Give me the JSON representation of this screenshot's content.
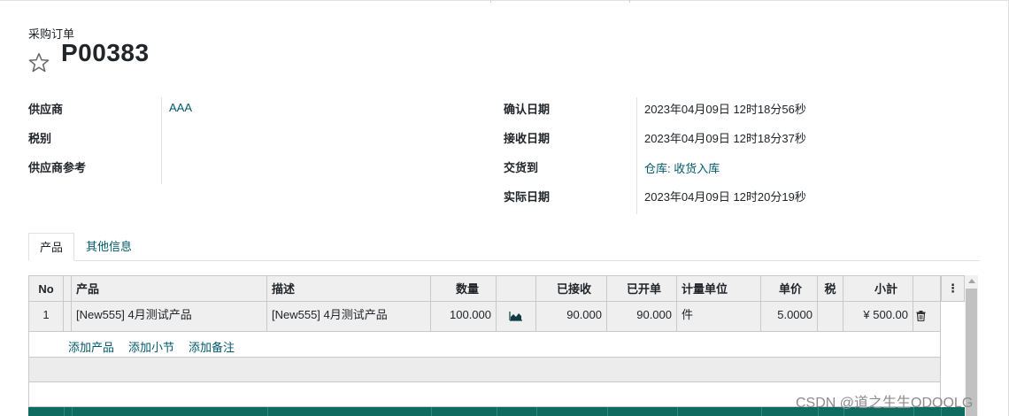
{
  "breadcrumb": "采购订单",
  "order_name": "P00383",
  "icons": {
    "favorite": "star-icon",
    "chart": "area-chart-icon",
    "delete": "trash-icon",
    "options": "kebab-icon"
  },
  "fields_left": [
    {
      "label": "供应商",
      "value": "AAA"
    },
    {
      "label": "税别",
      "value": ""
    },
    {
      "label": "供应商参考",
      "value": ""
    }
  ],
  "fields_right": [
    {
      "label": "确认日期",
      "value": "2023年04月09日 12时18分56秒"
    },
    {
      "label": "接收日期",
      "value": "2023年04月09日 12时18分37秒"
    },
    {
      "label": "交货到",
      "value": "仓库: 收货入库"
    },
    {
      "label": "实际日期",
      "value": "2023年04月09日 12时20分19秒"
    }
  ],
  "tabs": [
    {
      "label": "产品",
      "active": true
    },
    {
      "label": "其他信息",
      "active": false
    }
  ],
  "table": {
    "headers": {
      "no": "No",
      "product": "产品",
      "description": "描述",
      "quantity": "数量",
      "received": "已接收",
      "invoiced": "已开单",
      "uom": "计量单位",
      "price": "单价",
      "tax": "税",
      "subtotal": "小計"
    },
    "row": {
      "no": "1",
      "product": "[New555] 4月测试产品",
      "description": "[New555] 4月测试产品",
      "quantity": "100.000",
      "received": "90.000",
      "invoiced": "90.000",
      "uom": "件",
      "price": "5.0000",
      "tax": "",
      "subtotal": "¥ 500.00"
    },
    "options_glyph": "⋮",
    "add_links": {
      "product": "添加产品",
      "section": "添加小节",
      "note": "添加备注"
    }
  },
  "watermark": "CSDN @道之生生ODOOLG",
  "colors": {
    "link": "#00596b",
    "footer": "#0e6b5f",
    "header_bg": "#efefef"
  }
}
